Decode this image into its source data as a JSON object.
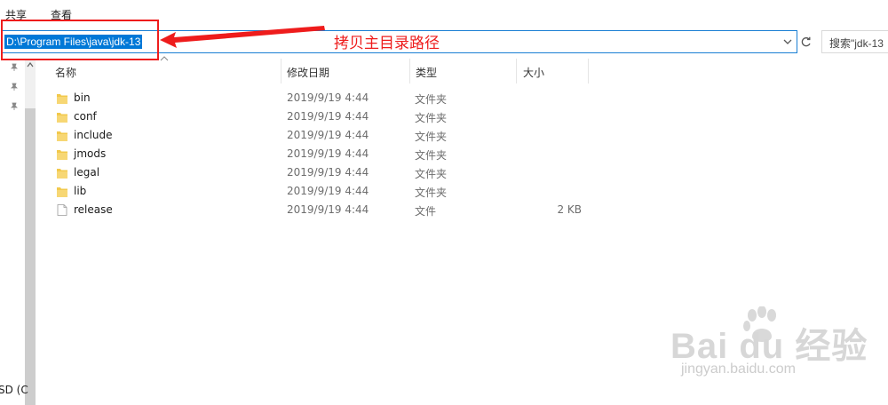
{
  "ribbon": {
    "tabs": [
      "共享",
      "查看"
    ]
  },
  "address_bar": {
    "path": "D:\\Program Files\\java\\jdk-13"
  },
  "search": {
    "placeholder": "搜索\"jdk-13"
  },
  "annotation": {
    "text": "拷贝主目录路径",
    "color": "#ee1c1c"
  },
  "nav": {
    "bottom_label": "SD (C"
  },
  "columns": {
    "name": "名称",
    "date": "修改日期",
    "type": "类型",
    "size": "大小"
  },
  "files": [
    {
      "name": "bin",
      "date": "2019/9/19 4:44",
      "type": "文件夹",
      "size": "",
      "icon": "folder-icon"
    },
    {
      "name": "conf",
      "date": "2019/9/19 4:44",
      "type": "文件夹",
      "size": "",
      "icon": "folder-icon"
    },
    {
      "name": "include",
      "date": "2019/9/19 4:44",
      "type": "文件夹",
      "size": "",
      "icon": "folder-icon"
    },
    {
      "name": "jmods",
      "date": "2019/9/19 4:44",
      "type": "文件夹",
      "size": "",
      "icon": "folder-icon"
    },
    {
      "name": "legal",
      "date": "2019/9/19 4:44",
      "type": "文件夹",
      "size": "",
      "icon": "folder-icon"
    },
    {
      "name": "lib",
      "date": "2019/9/19 4:44",
      "type": "文件夹",
      "size": "",
      "icon": "folder-icon"
    },
    {
      "name": "release",
      "date": "2019/9/19 4:44",
      "type": "文件",
      "size": "2 KB",
      "icon": "file-icon"
    }
  ],
  "watermark": {
    "main": "Bai du 经验",
    "sub": "jingyan.baidu.com"
  },
  "colors": {
    "selection": "#0078d7",
    "folder": "#f2c94c",
    "address_border": "#1a7fd4"
  }
}
